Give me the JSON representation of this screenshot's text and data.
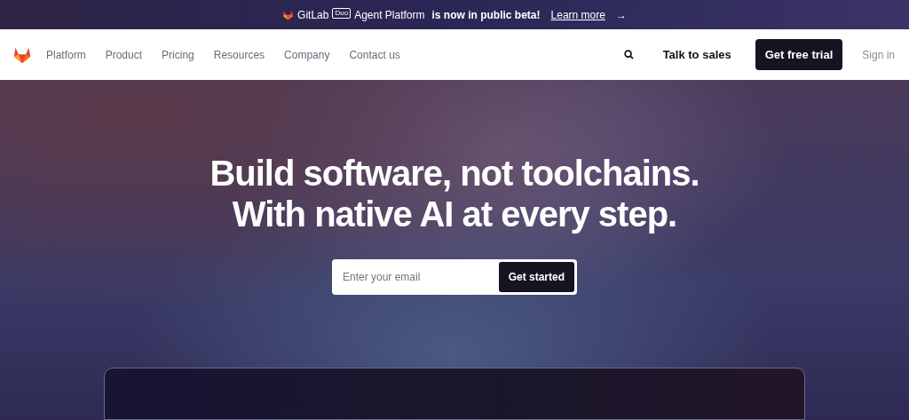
{
  "announcement": {
    "brand": "GitLab",
    "badge": "Duo",
    "product": "Agent Platform",
    "message": "is now in public beta!",
    "link": "Learn more",
    "arrow": "→"
  },
  "navbar": {
    "links": [
      "Platform",
      "Product",
      "Pricing",
      "Resources",
      "Company",
      "Contact us"
    ],
    "talk": "Talk to sales",
    "trial": "Get free trial",
    "signin": "Sign in"
  },
  "hero": {
    "headline_1": "Build software, not toolchains.",
    "headline_2": "With native AI at every step.",
    "email": {
      "placeholder": "Enter your email"
    },
    "cta": "Get started"
  }
}
